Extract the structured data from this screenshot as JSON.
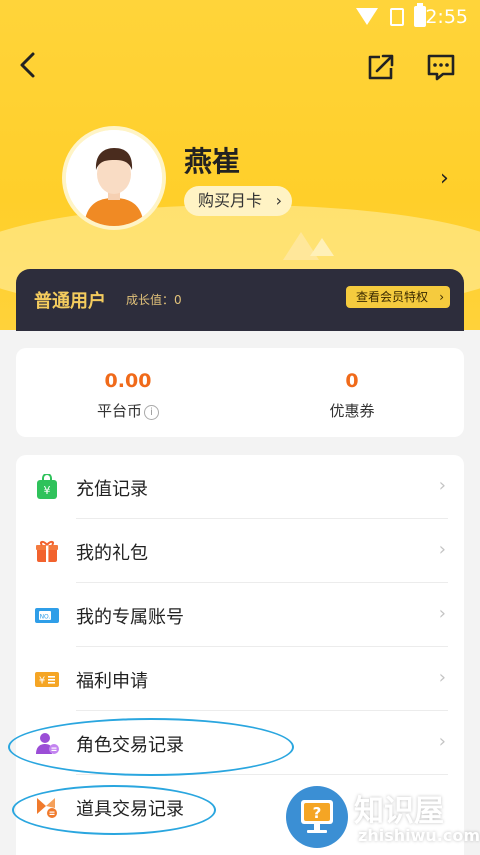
{
  "status_bar": {
    "time": "2:55"
  },
  "profile": {
    "name": "燕崔",
    "buy_month_card": "购买月卡"
  },
  "membership": {
    "level": "普通用户",
    "growth_label": "成长值：0",
    "privileges_button": "查看会员特权"
  },
  "assets": [
    {
      "value": "0.00",
      "label": "平台币"
    },
    {
      "value": "0",
      "label": "优惠券"
    }
  ],
  "menu_items": [
    {
      "label": "充值记录",
      "icon": "recharge-bag-icon"
    },
    {
      "label": "我的礼包",
      "icon": "gift-icon"
    },
    {
      "label": "我的专属账号",
      "icon": "ticket-no-icon"
    },
    {
      "label": "福利申请",
      "icon": "yen-ticket-icon"
    },
    {
      "label": "角色交易记录",
      "icon": "user-trade-icon"
    },
    {
      "label": "道具交易记录",
      "icon": "item-trade-icon"
    }
  ],
  "watermark": {
    "name": "知识屋",
    "url": "zhishiwu.com"
  },
  "colors": {
    "header_yellow": "#ffd43a",
    "accent_orange": "#f06a1a",
    "member_dark": "#2d2d3c",
    "highlight_ring": "#2aa6df"
  }
}
